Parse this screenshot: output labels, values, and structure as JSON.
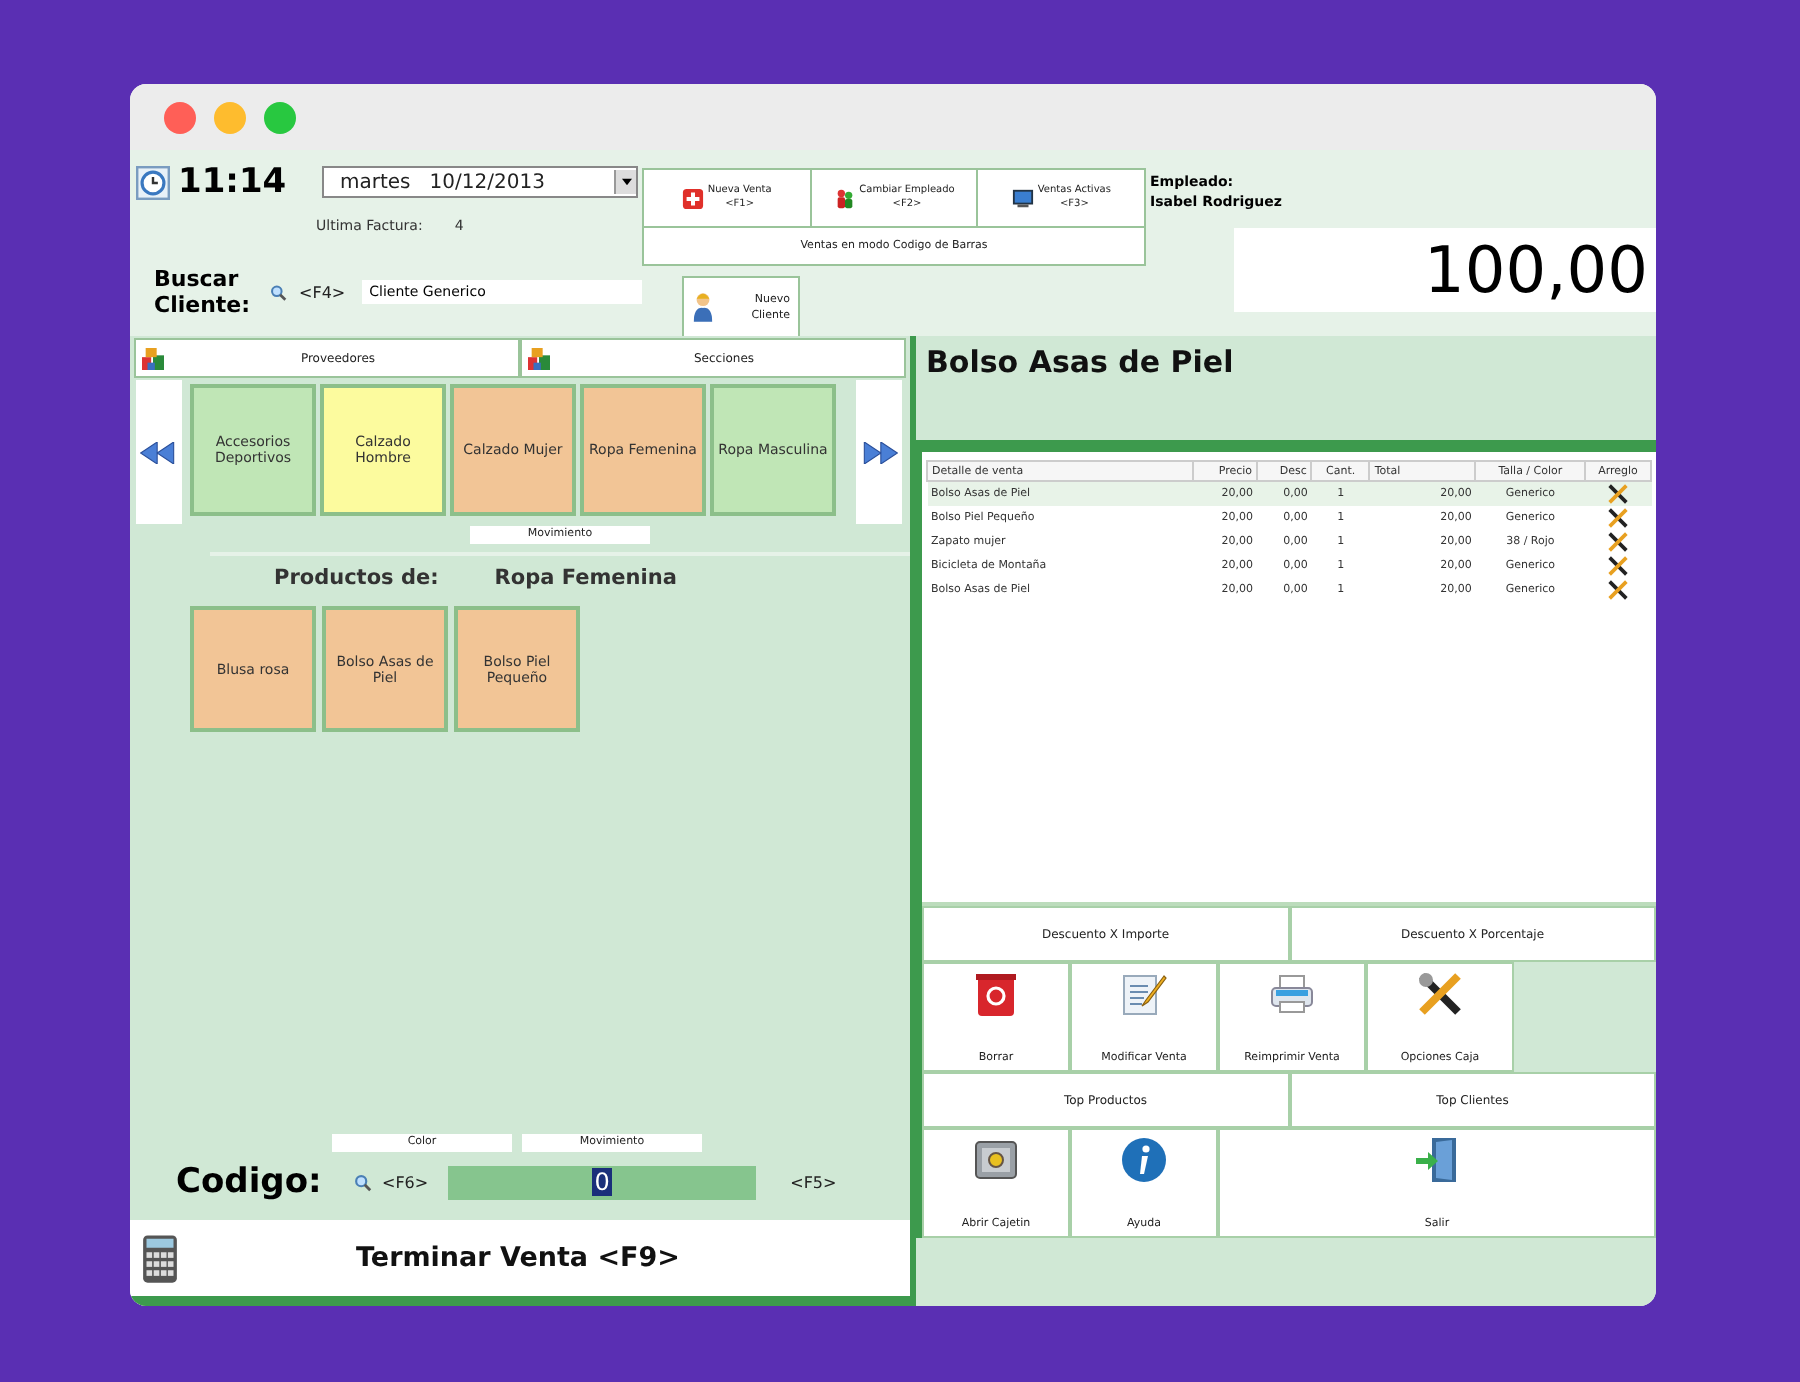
{
  "header": {
    "time": "11:14",
    "date": "martes   10/12/2013",
    "last_invoice_label": "Ultima Factura:",
    "last_invoice": "4",
    "customer_label": "Buscar Cliente:",
    "customer_key": "<F4>",
    "customer_value": "Cliente Generico",
    "actions": [
      {
        "label": "Nueva Venta",
        "key": "<F1>",
        "kind": "new"
      },
      {
        "label": "Cambiar Empleado",
        "key": "<F2>",
        "kind": "employee"
      },
      {
        "label": "Ventas Activas",
        "key": "<F3>",
        "kind": "active"
      }
    ],
    "barcode_mode": "Ventas en modo Codigo de Barras",
    "new_customer": "Nuevo Cliente",
    "employee_label": "Empleado:",
    "employee": "Isabel Rodriguez",
    "total": "100,00"
  },
  "filters": [
    {
      "label": "Proveedores"
    },
    {
      "label": "Secciones"
    }
  ],
  "categories": [
    {
      "label": "Accesorios Deportivos",
      "color": "#c0e6b6"
    },
    {
      "label": "Calzado Hombre",
      "color": "#fcfb9e"
    },
    {
      "label": "Calzado Mujer",
      "color": "#f2c596"
    },
    {
      "label": "Ropa Femenina",
      "color": "#f2c596"
    },
    {
      "label": "Ropa Masculina",
      "color": "#c0e6b6"
    }
  ],
  "categories_caption": "Movimiento",
  "products_label": "Productos de:",
  "products_category": "Ropa Femenina",
  "products": [
    {
      "label": "Blusa rosa",
      "color": "#f2c596"
    },
    {
      "label": "Bolso Asas de Piel",
      "color": "#f2c596"
    },
    {
      "label": "Bolso Piel Pequeño",
      "color": "#f2c596"
    }
  ],
  "bottom_captions": [
    "Color",
    "Movimiento"
  ],
  "code": {
    "label": "Codigo:",
    "search_key": "<F6>",
    "value": "0",
    "key": "<F5>"
  },
  "finish": "Terminar Venta <F9>",
  "current_product": "Bolso Asas de Piel",
  "table": {
    "columns": [
      "Detalle de venta",
      "Precio",
      "Desc",
      "Cant.",
      "Total",
      "Talla / Color",
      "Arreglo"
    ],
    "rows": [
      {
        "cells": [
          "Bolso Asas de Piel",
          "20,00",
          "0,00",
          "1",
          "20,00",
          "Generico"
        ],
        "selected": true
      },
      {
        "cells": [
          "Bolso Piel Pequeño",
          "20,00",
          "0,00",
          "1",
          "20,00",
          "Generico"
        ],
        "selected": false
      },
      {
        "cells": [
          "Zapato mujer",
          "20,00",
          "0,00",
          "1",
          "20,00",
          "38 / Rojo"
        ],
        "selected": false
      },
      {
        "cells": [
          "Bicicleta de Montaña",
          "20,00",
          "0,00",
          "1",
          "20,00",
          "Generico"
        ],
        "selected": false
      },
      {
        "cells": [
          "Bolso Asas de Piel",
          "20,00",
          "0,00",
          "1",
          "20,00",
          "Generico"
        ],
        "selected": false
      }
    ]
  },
  "discounts": [
    "Descuento X Importe",
    "Descuento X Porcentaje"
  ],
  "tools": [
    {
      "label": "Borrar",
      "kind": "trash"
    },
    {
      "label": "Modificar Venta",
      "kind": "edit"
    },
    {
      "label": "Reimprimir Venta",
      "kind": "print"
    },
    {
      "label": "Opciones Caja",
      "kind": "tools"
    }
  ],
  "tops": [
    "Top Productos",
    "Top Clientes"
  ],
  "bottom_tools": [
    {
      "label": "Abrir Cajetin",
      "kind": "safe"
    },
    {
      "label": "Ayuda",
      "kind": "info"
    },
    {
      "label": "Salir",
      "kind": "exit"
    }
  ]
}
